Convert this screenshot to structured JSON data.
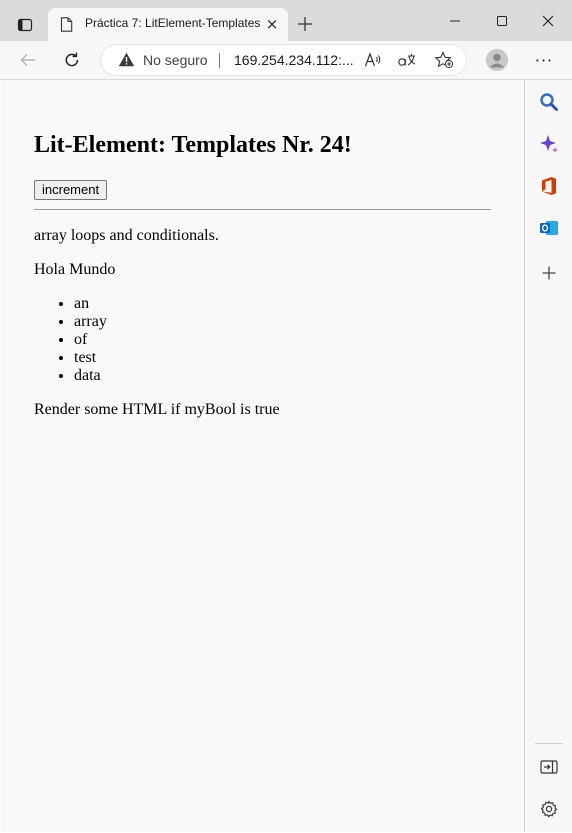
{
  "browser": {
    "tab": {
      "title": "Práctica 7: LitElement-Templates",
      "close_glyph": "×"
    },
    "new_tab_glyph": "+",
    "address": {
      "security_label": "No seguro",
      "url": "169.254.234.112:..."
    },
    "icons": {
      "tab_actions": "tab-actions-icon",
      "page": "page-icon",
      "back": "back-arrow-icon",
      "refresh": "refresh-icon",
      "warning": "warning-icon",
      "read_aloud": "read-aloud-icon",
      "translate": "translate-icon",
      "favorite": "favorite-add-icon",
      "profile": "profile-avatar-icon",
      "more": "more-icon",
      "minimize": "minimize-icon",
      "maximize": "maximize-icon",
      "close": "close-icon"
    },
    "more_glyph": "···",
    "sidebar": {
      "items": [
        "search-icon",
        "copilot-icon",
        "office-icon",
        "outlook-icon",
        "add-icon"
      ],
      "bottom": [
        "hide-sidebar-icon",
        "settings-icon"
      ],
      "add_glyph": "+"
    }
  },
  "page": {
    "heading": "Lit-Element: Templates Nr. 24!",
    "button_label": "increment",
    "intro": "array loops and conditionals.",
    "greeting": "Hola Mundo",
    "list_items": [
      "an",
      "array",
      "of",
      "test",
      "data"
    ],
    "conditional_text": "Render some HTML if myBool is true"
  },
  "colors": {
    "titlebar": "#dbdbdb",
    "toolbar": "#f7f7f7",
    "content_bg": "#f9f9f9",
    "search_blue": "#2c6bd6",
    "office_red": "#d83b01",
    "outlook_blue": "#0a64c4"
  }
}
